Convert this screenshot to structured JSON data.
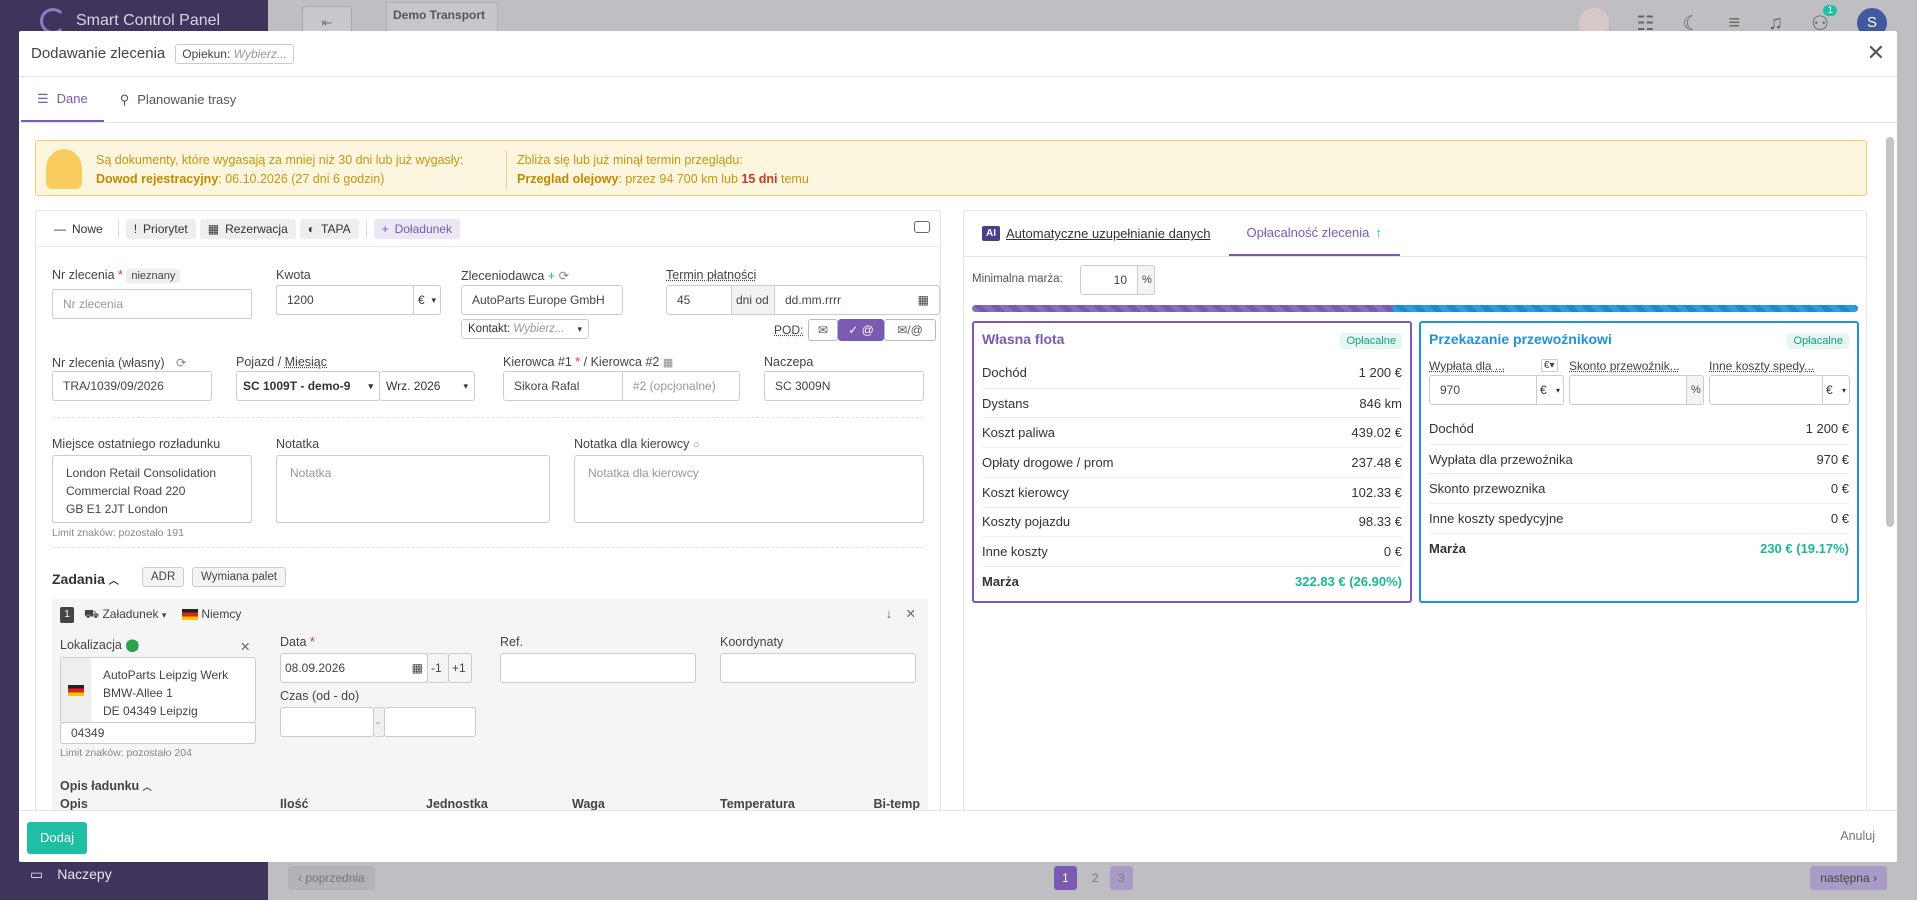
{
  "background": {
    "app_title": "Smart Control Panel",
    "sidebar_bottom_item": "Naczepy",
    "header_back_icon": "collapse-sidebar-icon",
    "company": "Demo Transport",
    "notif_count": "1",
    "avatar_letter": "S",
    "pager_prev": "poprzednia",
    "pager_next": "następna",
    "pages": [
      "1",
      "2",
      "3"
    ]
  },
  "modal": {
    "title": "Dodawanie zlecenia",
    "opiekun_label": "Opiekun:",
    "opiekun_value": "Wybierz...",
    "tabs": {
      "dane": "Dane",
      "trasa": "Planowanie trasy"
    }
  },
  "alert": {
    "line1": "Są dokumenty, które wygasają za mniej niż 30 dni lub już wygasły:",
    "doc_name": "Dowod rejestracyjny",
    "doc_detail": ": 06.10.2026 (27 dni 6 godzin)",
    "line2": "Zbliża się lub już minął termin przeglądu:",
    "check_name": "Przeglad olejowy",
    "check_detail_a": ": przez 94 700 km lub ",
    "check_days": "15 dni",
    "check_detail_b": " temu"
  },
  "toolbar": {
    "nowe": "Nowe",
    "priorytet": "Priorytet",
    "rezerwacja": "Rezerwacja",
    "tapa": "TAPA",
    "doladunek": "Doładunek"
  },
  "form": {
    "nr_label": "Nr zlecenia",
    "nr_badge": "nieznany",
    "nr_placeholder": "Nr zlecenia",
    "kwota_label": "Kwota",
    "kwota_value": "1200",
    "currency": "€",
    "zleceniodawca_label": "Zleceniodawca",
    "zleceniodawca_value": "AutoParts Europe GmbH",
    "kontakt_label": "Kontakt:",
    "kontakt_value": "Wybierz...",
    "termin_label": "Termin płatności",
    "termin_days": "45",
    "termin_dni": "dni od",
    "termin_date": "dd.mm.rrrr",
    "pod_label": "POD:",
    "nr_wlasny_label": "Nr zlecenia (własny)",
    "nr_wlasny_value": "TRA/1039/09/2026",
    "pojazd_label": "Pojazd / ",
    "miesiac_label": "Miesiąc",
    "pojazd_value": "SC 1009T - demo-9",
    "miesiac_value": "Wrz. 2026",
    "kierowca1_label": "Kierowca #1",
    "kierowca2_label": " / Kierowca #2",
    "kierowca1_value": "Sikora Rafal",
    "kierowca2_placeholder": "#2 (opcjonalne)",
    "naczepa_label": "Naczepa",
    "naczepa_value": "SC 3009N",
    "miejsce_label": "Miejsce ostatniego rozładunku",
    "miejsce_value": "London Retail Consolidation\nCommercial Road 220\nGB E1 2JT London",
    "miejsce_hint": "Limit znaków: pozostało 191",
    "notatka_label": "Notatka",
    "notatka_placeholder": "Notatka",
    "notatka_kier_label": "Notatka dla kierowcy",
    "notatka_kier_placeholder": "Notatka dla kierowcy"
  },
  "tasks": {
    "title": "Zadania",
    "adr": "ADR",
    "wymiana": "Wymiana palet",
    "task1": {
      "number": "1",
      "type": "Załadunek",
      "country": "Niemcy",
      "lokalizacja_label": "Lokalizacja",
      "address": "AutoParts Leipzig Werk\nBMW-Allee 1\nDE 04349 Leipzig",
      "postal": "04349",
      "hint": "Limit znaków: pozostało 204",
      "data_label": "Data",
      "data_value": "08.09.2026",
      "minus": "-1",
      "plus": "+1",
      "czas_label": "Czas (od - do)",
      "czas_sep": "-",
      "ref_label": "Ref.",
      "koordynaty_label": "Koordynaty",
      "opis_ladunku": "Opis ładunku",
      "opis": "Opis",
      "ilosc": "Ilość",
      "jednostka": "Jednostka",
      "waga": "Waga",
      "temperatura": "Temperatura",
      "bitemp": "Bi-temp"
    }
  },
  "right": {
    "tab_auto": "Automatyczne uzupełnianie danych",
    "tab_oplacalnosc": "Opłacalność zlecenia",
    "min_marza_label": "Minimalna marża:",
    "min_marza_value": "10",
    "percent": "%",
    "own": {
      "title": "Własna flota",
      "badge": "Opłacalne",
      "rows": [
        {
          "label": "Dochód",
          "value": "1 200 €"
        },
        {
          "label": "Dystans",
          "value": "846 km"
        },
        {
          "label": "Koszt paliwa",
          "value": "439.02 €"
        },
        {
          "label": "Opłaty drogowe / prom",
          "value": "237.48 €"
        },
        {
          "label": "Koszt kierowcy",
          "value": "102.33 €"
        },
        {
          "label": "Koszty pojazdu",
          "value": "98.33 €"
        },
        {
          "label": "Inne koszty",
          "value": "0 €"
        }
      ],
      "total_label": "Marża",
      "total_value": "322.83 € (26.90%)"
    },
    "carrier": {
      "title": "Przekazanie przewoźnikowi",
      "badge": "Opłacalne",
      "col1_label": "Wypłata dla ...",
      "col1_value": "970",
      "col2_label": "Skonto przewoźnik...",
      "col3_label": "Inne koszty spedy...",
      "rows": [
        {
          "label": "Dochód",
          "value": "1 200 €"
        },
        {
          "label": "Wypłata dla przewoźnika",
          "value": "970 €"
        },
        {
          "label": "Skonto przewoznika",
          "value": "0 €"
        },
        {
          "label": "Inne koszty spedycyjne",
          "value": "0 €"
        }
      ],
      "total_label": "Marża",
      "total_value": "230 € (19.17%)"
    },
    "margin_split": {
      "own_fraction": 0.475
    }
  },
  "footer": {
    "dodaj": "Dodaj",
    "anuluj": "Anuluj"
  },
  "colors": {
    "accent": "#7a5ab3",
    "carrier": "#1f92d8",
    "success": "#1fbfa3",
    "warning": "#f2cf77"
  }
}
